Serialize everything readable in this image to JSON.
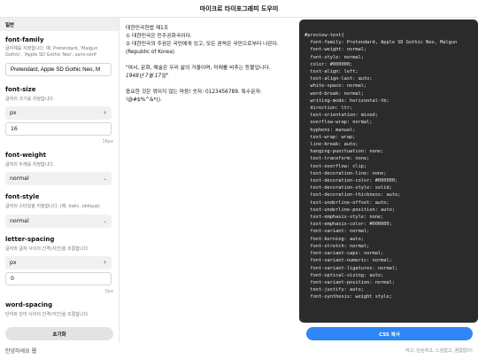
{
  "app": {
    "title": "마이크로 타이포그래피 도우미"
  },
  "sidebar": {
    "section_label": "일반",
    "font_family": {
      "title": "font-family",
      "description": "글자체를 지정합니다. 예: Pretendard, 'Malgun Gothic', 'Apple SD Gothic Neo', sans-serif",
      "value": "Pretendard, Apple SD Gothic Neo, M"
    },
    "font_size": {
      "title": "font-size",
      "description": "글자의 크기를 지정합니다.",
      "unit_select": "px",
      "value": "16",
      "unit_hint": "16px"
    },
    "font_weight": {
      "title": "font-weight",
      "description": "글자의 두께를 지정합니다.",
      "value": "normal"
    },
    "font_style": {
      "title": "font-style",
      "description": "글자의 스타일을 지정합니다. (예: italic, oblique)",
      "value": "normal"
    },
    "letter_spacing": {
      "title": "letter-spacing",
      "description": "글자와 글자 사이의 간격(자간)을 조절합니다.",
      "unit_select": "px",
      "value": "0",
      "unit_hint": "0px"
    },
    "word_spacing": {
      "title": "word-spacing",
      "description": "단어와 단어 사이의 간격(어간)을 조절합니다."
    },
    "reset_label": "초기화"
  },
  "preview": {
    "line1": "대한민국헌법 제1조",
    "line2": "① 대한민국은 민주공화국이다.",
    "line3": "② 대한민국의 주권은 국민에게 있고, 모든 권력은 국민으로부터 나온다. (Republic of Korea)",
    "line4": "\"여서, 문화, 예술은 우리 삶의 거울이며, 미래를 비추는 등불입니다.",
    "line5": "1948년 7월 17일\"",
    "line6": "중요한 것은 꺾이지 않는 마음! 숫자: 0123456789. 특수문자: !@#$%^&*()."
  },
  "code": {
    "text": "#preview-text{\n  font-family: Pretendard, Apple SD Gothic Neo, Malgun\n  font-weight: normal;\n  font-style: normal;\n  color: #000000;\n  text-align: left;\n  text-align-last: auto;\n  white-space: normal;\n  word-break: normal;\n  writing-mode: horizontal-tb;\n  direction: ltr;\n  text-orientation: mixed;\n  overflow-wrap: normal;\n  hyphens: manual;\n  text-wrap: wrap;\n  line-break: auto;\n  hanging-punctuation: none;\n  text-transform: none;\n  text-overflow: clip;\n  text-decoration-line: none;\n  text-decoration-color: #000000;\n  text-decoration-style: solid;\n  text-decoration-thickness: auto;\n  text-underline-offset: auto;\n  text-underline-position: auto;\n  text-emphasis-style: none;\n  text-emphasis-color: #000000;\n  font-variant: normal;\n  font-kerning: auto;\n  font-stretch: normal;\n  font-variant-caps: normal;\n  font-variant-numeric: normal;\n  font-variant-ligatures: normal;\n  font-optical-sizing: auto;\n  font-variant-position: normal;\n  text-justify: auto;\n  font-synthesis: weight style;",
    "copy_label": "CSS 복사"
  },
  "footer": {
    "left": "안녕하세요 웹",
    "right": "작고, 단순하고, 느낌없고, 꿈없없이!"
  },
  "colors": {
    "accent": "#2f86f6",
    "code_bg": "#2b2b2b"
  }
}
